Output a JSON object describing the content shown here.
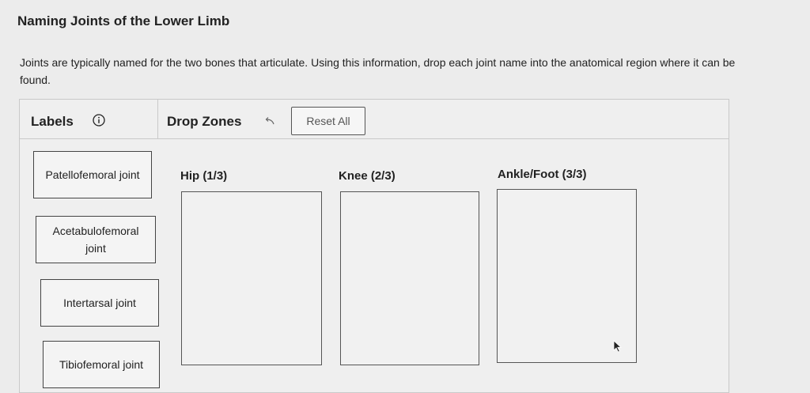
{
  "page": {
    "title": "Naming Joints of the Lower Limb",
    "instructions": "Joints are typically named for the two bones that articulate. Using this information, drop each joint name into the anatomical region where it can be found."
  },
  "toolbar": {
    "labels_header": "Labels",
    "drop_zones_header": "Drop Zones",
    "reset_label": "Reset All"
  },
  "labels": [
    {
      "text": "Patellofemoral joint"
    },
    {
      "text": "Acetabulofemoral joint"
    },
    {
      "text": "Intertarsal joint"
    },
    {
      "text": "Tibiofemoral joint"
    }
  ],
  "zones": [
    {
      "title": "Hip (1/3)"
    },
    {
      "title": "Knee (2/3)"
    },
    {
      "title": "Ankle/Foot (3/3)"
    }
  ],
  "icons": {
    "info": "info-icon",
    "undo": "undo-arrow-icon",
    "cursor": "mouse-pointer-icon"
  }
}
